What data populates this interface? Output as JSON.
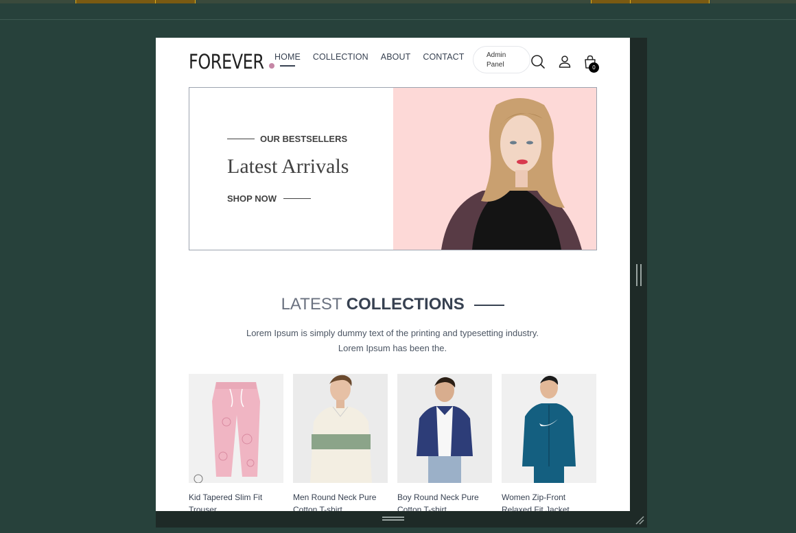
{
  "brand": {
    "logo_text": "FOREVER",
    "dot_color": "#c586a5"
  },
  "nav": {
    "items": [
      {
        "label": "HOME",
        "active": true
      },
      {
        "label": "COLLECTION",
        "active": false
      },
      {
        "label": "ABOUT",
        "active": false
      },
      {
        "label": "CONTACT",
        "active": false
      }
    ],
    "admin_line1": "Admin",
    "admin_line2": "Panel",
    "cart_count": "0"
  },
  "hero": {
    "eyebrow": "OUR BESTSELLERS",
    "title": "Latest Arrivals",
    "cta": "SHOP NOW",
    "bg_color": "#fdd9d7"
  },
  "collections": {
    "title_light": "LATEST",
    "title_bold": "COLLECTIONS",
    "description": "Lorem Ipsum is simply dummy text of the printing and typesetting industry. Lorem Ipsum has been the."
  },
  "products": [
    {
      "name": "Kid Tapered Slim Fit Trouser",
      "icon": "pink-trousers"
    },
    {
      "name": "Men Round Neck Pure Cotton T-shirt",
      "icon": "striped-polo"
    },
    {
      "name": "Boy Round Neck Pure Cotton T-shirt",
      "icon": "navy-shirt"
    },
    {
      "name": "Women Zip-Front Relaxed Fit Jacket",
      "icon": "teal-jacket"
    }
  ],
  "colors": {
    "page_bg": "#27413b",
    "frame": "#1e2a27",
    "text": "#374151"
  }
}
